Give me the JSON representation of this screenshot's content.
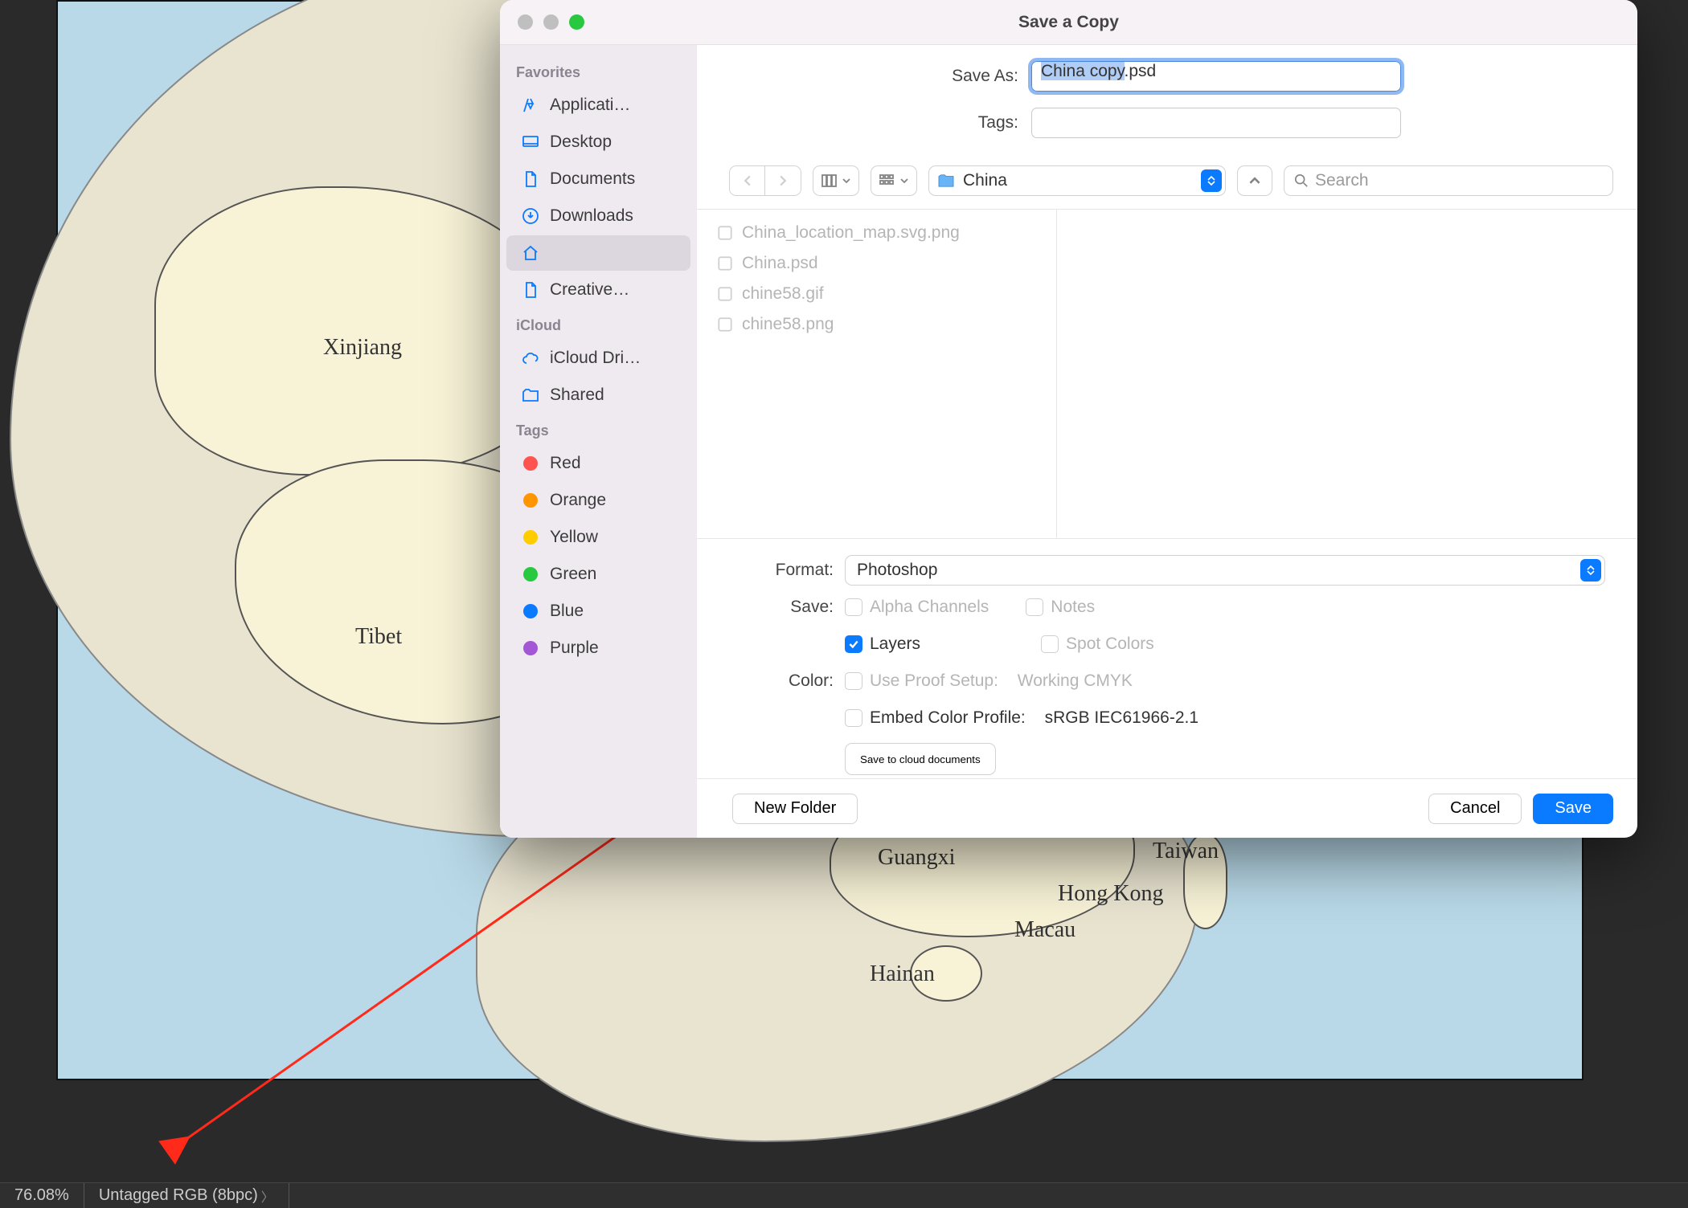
{
  "status": {
    "zoom": "76.08%",
    "color_profile": "Untagged RGB (8bpc)"
  },
  "map": {
    "labels": [
      "Xinjiang",
      "Tibet",
      "Guangxi",
      "Hainan",
      "Macau",
      "Hong Kong",
      "Taiwan"
    ]
  },
  "dialog": {
    "title": "Save a Copy",
    "save_as_label": "Save As:",
    "filename_selected": "China copy",
    "filename_ext": ".psd",
    "tags_label": "Tags:",
    "location_name": "China",
    "search_placeholder": "Search",
    "sidebar": {
      "favorites_title": "Favorites",
      "favorites": [
        {
          "label": "Applicati…",
          "icon": "app"
        },
        {
          "label": "Desktop",
          "icon": "desktop"
        },
        {
          "label": "Documents",
          "icon": "doc"
        },
        {
          "label": "Downloads",
          "icon": "down"
        },
        {
          "label": "",
          "icon": "home",
          "selected": true
        },
        {
          "label": "Creative…",
          "icon": "doc"
        }
      ],
      "icloud_title": "iCloud",
      "icloud": [
        {
          "label": "iCloud Dri…",
          "icon": "cloud"
        },
        {
          "label": "Shared",
          "icon": "shared"
        }
      ],
      "tags_title": "Tags",
      "tags": [
        {
          "label": "Red",
          "color": "#ff5350"
        },
        {
          "label": "Orange",
          "color": "#ff9500"
        },
        {
          "label": "Yellow",
          "color": "#ffcc00"
        },
        {
          "label": "Green",
          "color": "#28c840"
        },
        {
          "label": "Blue",
          "color": "#0a7aff"
        },
        {
          "label": "Purple",
          "color": "#a357d7"
        }
      ]
    },
    "files": [
      "China_location_map.svg.png",
      "China.psd",
      "chine58.gif",
      "chine58.png"
    ],
    "format_label": "Format:",
    "format_value": "Photoshop",
    "save_label": "Save:",
    "color_label": "Color:",
    "options": {
      "alpha": {
        "label": "Alpha Channels",
        "enabled": false,
        "checked": false
      },
      "notes": {
        "label": "Notes",
        "enabled": false,
        "checked": false
      },
      "layers": {
        "label": "Layers",
        "enabled": true,
        "checked": true
      },
      "spot": {
        "label": "Spot Colors",
        "enabled": false,
        "checked": false
      },
      "proof": {
        "label": "Use Proof Setup:",
        "enabled": false,
        "checked": false,
        "value": "Working CMYK"
      },
      "embed": {
        "label": "Embed Color Profile:",
        "enabled": true,
        "checked": false,
        "value": "sRGB IEC61966-2.1"
      }
    },
    "cloud_button": "Save to cloud documents",
    "footer": {
      "new_folder": "New Folder",
      "cancel": "Cancel",
      "save": "Save"
    }
  }
}
